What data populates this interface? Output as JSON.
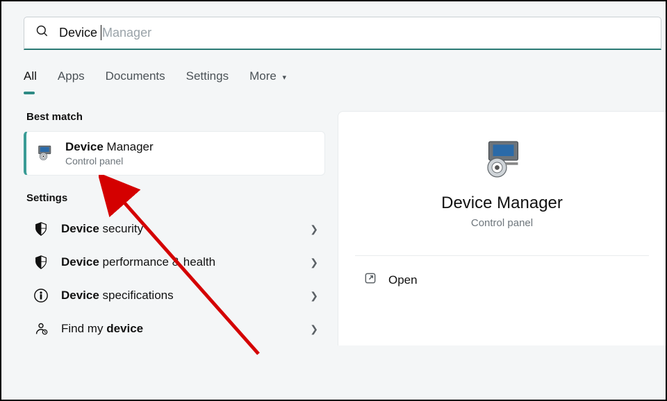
{
  "search": {
    "typed": "Device ",
    "completion": "Manager"
  },
  "filters": [
    "All",
    "Apps",
    "Documents",
    "Settings",
    "More"
  ],
  "active_filter_index": 0,
  "best_match": {
    "section_label": "Best match",
    "title_bold": "Device",
    "title_rest": " Manager",
    "subtitle": "Control panel"
  },
  "settings": {
    "section_label": "Settings",
    "items": [
      {
        "bold": "Device",
        "rest": " security",
        "icon": "shield"
      },
      {
        "bold": "Device",
        "rest": " performance & health",
        "icon": "shield"
      },
      {
        "bold": "Device",
        "rest": " specifications",
        "icon": "info"
      },
      {
        "bold_after": "device",
        "pre": "Find my ",
        "icon": "location"
      }
    ]
  },
  "detail": {
    "title": "Device Manager",
    "subtitle": "Control panel",
    "open_label": "Open"
  }
}
